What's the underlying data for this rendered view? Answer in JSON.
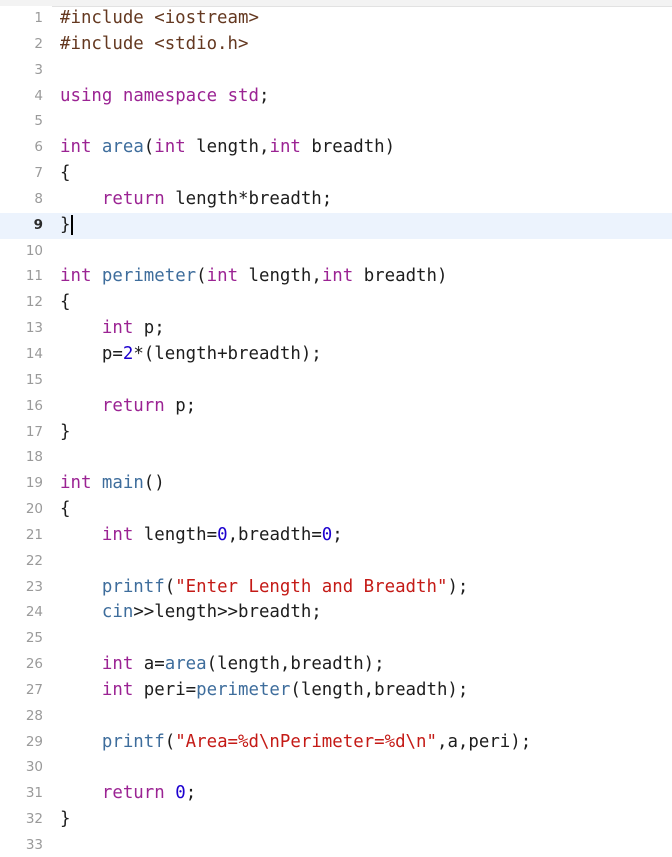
{
  "editor": {
    "current_line": 9,
    "lines": [
      {
        "n": "1",
        "t": [
          {
            "c": "pp",
            "v": "#include "
          },
          {
            "c": "inc",
            "v": "<iostream>"
          }
        ]
      },
      {
        "n": "2",
        "t": [
          {
            "c": "pp",
            "v": "#include "
          },
          {
            "c": "inc",
            "v": "<stdio.h>"
          }
        ]
      },
      {
        "n": "3",
        "t": []
      },
      {
        "n": "4",
        "t": [
          {
            "c": "kw",
            "v": "using"
          },
          {
            "c": "pl",
            "v": " "
          },
          {
            "c": "kw",
            "v": "namespace"
          },
          {
            "c": "pl",
            "v": " "
          },
          {
            "c": "kw",
            "v": "std"
          },
          {
            "c": "pl",
            "v": ";"
          }
        ]
      },
      {
        "n": "5",
        "t": []
      },
      {
        "n": "6",
        "t": [
          {
            "c": "kw",
            "v": "int"
          },
          {
            "c": "pl",
            "v": " "
          },
          {
            "c": "fn",
            "v": "area"
          },
          {
            "c": "pl",
            "v": "("
          },
          {
            "c": "kw",
            "v": "int"
          },
          {
            "c": "pl",
            "v": " length,"
          },
          {
            "c": "kw",
            "v": "int"
          },
          {
            "c": "pl",
            "v": " breadth)"
          }
        ]
      },
      {
        "n": "7",
        "t": [
          {
            "c": "pl",
            "v": "{"
          }
        ]
      },
      {
        "n": "8",
        "t": [
          {
            "c": "pl",
            "v": "    "
          },
          {
            "c": "kw",
            "v": "return"
          },
          {
            "c": "pl",
            "v": " length*breadth;"
          }
        ]
      },
      {
        "n": "9",
        "t": [
          {
            "c": "pl",
            "v": "}"
          }
        ],
        "caret": true
      },
      {
        "n": "10",
        "t": []
      },
      {
        "n": "11",
        "t": [
          {
            "c": "kw",
            "v": "int"
          },
          {
            "c": "pl",
            "v": " "
          },
          {
            "c": "fn",
            "v": "perimeter"
          },
          {
            "c": "pl",
            "v": "("
          },
          {
            "c": "kw",
            "v": "int"
          },
          {
            "c": "pl",
            "v": " length,"
          },
          {
            "c": "kw",
            "v": "int"
          },
          {
            "c": "pl",
            "v": " breadth)"
          }
        ]
      },
      {
        "n": "12",
        "t": [
          {
            "c": "pl",
            "v": "{"
          }
        ]
      },
      {
        "n": "13",
        "t": [
          {
            "c": "pl",
            "v": "    "
          },
          {
            "c": "kw",
            "v": "int"
          },
          {
            "c": "pl",
            "v": " p;"
          }
        ]
      },
      {
        "n": "14",
        "t": [
          {
            "c": "pl",
            "v": "    p="
          },
          {
            "c": "num",
            "v": "2"
          },
          {
            "c": "pl",
            "v": "*(length+breadth);"
          }
        ]
      },
      {
        "n": "15",
        "t": []
      },
      {
        "n": "16",
        "t": [
          {
            "c": "pl",
            "v": "    "
          },
          {
            "c": "kw",
            "v": "return"
          },
          {
            "c": "pl",
            "v": " p;"
          }
        ]
      },
      {
        "n": "17",
        "t": [
          {
            "c": "pl",
            "v": "}"
          }
        ]
      },
      {
        "n": "18",
        "t": []
      },
      {
        "n": "19",
        "t": [
          {
            "c": "kw",
            "v": "int"
          },
          {
            "c": "pl",
            "v": " "
          },
          {
            "c": "fn",
            "v": "main"
          },
          {
            "c": "pl",
            "v": "()"
          }
        ]
      },
      {
        "n": "20",
        "t": [
          {
            "c": "pl",
            "v": "{"
          }
        ]
      },
      {
        "n": "21",
        "t": [
          {
            "c": "pl",
            "v": "    "
          },
          {
            "c": "kw",
            "v": "int"
          },
          {
            "c": "pl",
            "v": " length="
          },
          {
            "c": "num",
            "v": "0"
          },
          {
            "c": "pl",
            "v": ",breadth="
          },
          {
            "c": "num",
            "v": "0"
          },
          {
            "c": "pl",
            "v": ";"
          }
        ]
      },
      {
        "n": "22",
        "t": []
      },
      {
        "n": "23",
        "t": [
          {
            "c": "pl",
            "v": "    "
          },
          {
            "c": "fn",
            "v": "printf"
          },
          {
            "c": "pl",
            "v": "("
          },
          {
            "c": "str",
            "v": "\"Enter Length and Breadth\""
          },
          {
            "c": "pl",
            "v": ");"
          }
        ]
      },
      {
        "n": "24",
        "t": [
          {
            "c": "pl",
            "v": "    "
          },
          {
            "c": "fn",
            "v": "cin"
          },
          {
            "c": "pl",
            "v": ">>length>>breadth;"
          }
        ]
      },
      {
        "n": "25",
        "t": []
      },
      {
        "n": "26",
        "t": [
          {
            "c": "pl",
            "v": "    "
          },
          {
            "c": "kw",
            "v": "int"
          },
          {
            "c": "pl",
            "v": " a="
          },
          {
            "c": "fn",
            "v": "area"
          },
          {
            "c": "pl",
            "v": "(length,breadth);"
          }
        ]
      },
      {
        "n": "27",
        "t": [
          {
            "c": "pl",
            "v": "    "
          },
          {
            "c": "kw",
            "v": "int"
          },
          {
            "c": "pl",
            "v": " peri="
          },
          {
            "c": "fn",
            "v": "perimeter"
          },
          {
            "c": "pl",
            "v": "(length,breadth);"
          }
        ]
      },
      {
        "n": "28",
        "t": []
      },
      {
        "n": "29",
        "t": [
          {
            "c": "pl",
            "v": "    "
          },
          {
            "c": "fn",
            "v": "printf"
          },
          {
            "c": "pl",
            "v": "("
          },
          {
            "c": "str",
            "v": "\"Area=%d\\nPerimeter=%d\\n\""
          },
          {
            "c": "pl",
            "v": ",a,peri);"
          }
        ]
      },
      {
        "n": "30",
        "t": []
      },
      {
        "n": "31",
        "t": [
          {
            "c": "pl",
            "v": "    "
          },
          {
            "c": "kw",
            "v": "return"
          },
          {
            "c": "pl",
            "v": " "
          },
          {
            "c": "num",
            "v": "0"
          },
          {
            "c": "pl",
            "v": ";"
          }
        ]
      },
      {
        "n": "32",
        "t": [
          {
            "c": "pl",
            "v": "}"
          }
        ]
      },
      {
        "n": "33",
        "t": []
      }
    ]
  },
  "colors": {
    "keyword": "#9b2393",
    "function": "#3e6d9c",
    "string": "#c41a16",
    "number": "#1c00cf",
    "preprocessor": "#643820",
    "plain": "#1d1d1d",
    "line_number": "#9a9a9a",
    "current_line_highlight": "#ecf3fd"
  }
}
